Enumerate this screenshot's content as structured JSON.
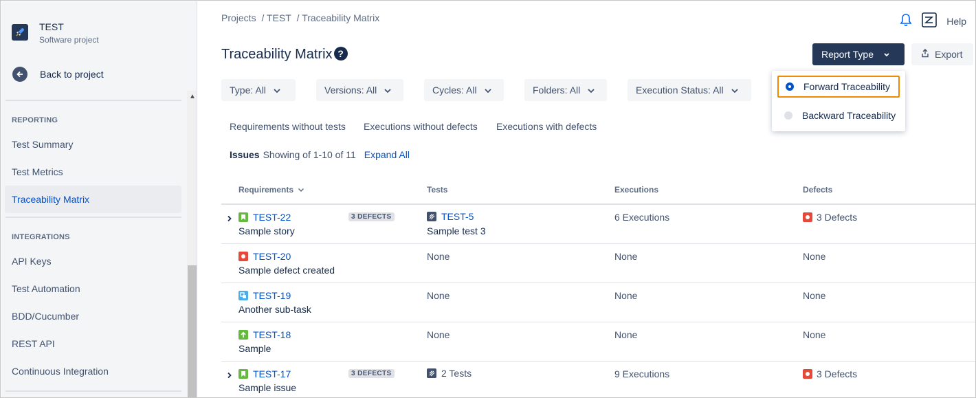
{
  "project": {
    "name": "TEST",
    "type": "Software project"
  },
  "sidebar": {
    "back_label": "Back to project",
    "sections": [
      {
        "title": "REPORTING",
        "items": [
          "Test Summary",
          "Test Metrics",
          "Traceability Matrix"
        ]
      },
      {
        "title": "INTEGRATIONS",
        "items": [
          "API Keys",
          "Test Automation",
          "BDD/Cucumber",
          "REST API",
          "Continuous Integration"
        ]
      }
    ],
    "active_item": "Traceability Matrix"
  },
  "breadcrumb": [
    "Projects",
    "/ TEST",
    "/ Traceability Matrix"
  ],
  "header": {
    "help_label": "Help"
  },
  "page": {
    "title": "Traceability Matrix",
    "help_glyph": "?"
  },
  "toolbar": {
    "report_type_label": "Report Type",
    "export_label": "Export"
  },
  "report_menu": {
    "options": [
      {
        "label": "Forward Traceability",
        "selected": true
      },
      {
        "label": "Backward Traceability",
        "selected": false
      }
    ]
  },
  "filters": [
    "Type: All",
    "Versions: All",
    "Cycles: All",
    "Folders: All",
    "Execution Status: All"
  ],
  "quick_tabs": [
    "Requirements without tests",
    "Executions without defects",
    "Executions with defects"
  ],
  "issues": {
    "label": "Issues",
    "showing": "Showing of 1-10 of 11",
    "expand_all": "Expand All"
  },
  "table": {
    "headers": [
      "Requirements",
      "Tests",
      "Executions",
      "Defects"
    ],
    "rows": [
      {
        "key": "TEST-22",
        "type": "story",
        "summary": "Sample story",
        "badge": "3 DEFECTS",
        "expandable": true,
        "test_key": "TEST-5",
        "test_summary": "Sample test 3",
        "executions": "6 Executions",
        "defects": "3 Defects"
      },
      {
        "key": "TEST-20",
        "type": "bug",
        "summary": "Sample defect created",
        "badge": "",
        "expandable": false,
        "tests": "None",
        "executions": "None",
        "defects": "None"
      },
      {
        "key": "TEST-19",
        "type": "subtask",
        "summary": "Another sub-task",
        "badge": "",
        "expandable": false,
        "tests": "None",
        "executions": "None",
        "defects": "None"
      },
      {
        "key": "TEST-18",
        "type": "improvement",
        "summary": "Sample",
        "badge": "",
        "expandable": false,
        "tests": "None",
        "executions": "None",
        "defects": "None"
      },
      {
        "key": "TEST-17",
        "type": "story",
        "summary": "Sample issue",
        "badge": "3 DEFECTS",
        "expandable": true,
        "tests": "2 Tests",
        "executions": "9 Executions",
        "defects": "3 Defects"
      }
    ]
  },
  "colors": {
    "accent": "#0052cc",
    "primary_button": "#253858",
    "highlight_border": "#f08a00",
    "defect": "#e5493a",
    "story": "#63ba3c",
    "subtask": "#4bade8"
  }
}
